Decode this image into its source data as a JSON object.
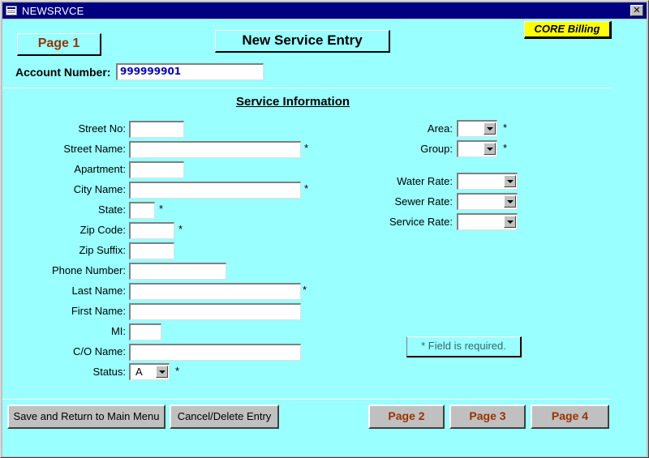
{
  "window": {
    "title": "NEWSRVCE",
    "close_glyph": "✕"
  },
  "header": {
    "page_label": "Page 1",
    "form_title": "New Service Entry",
    "badge": "CORE Billing",
    "account_number_label": "Account Number:",
    "account_number_value": "999999901"
  },
  "section": {
    "title": "Service Information"
  },
  "left_fields": {
    "street_no": {
      "label": "Street No:",
      "value": ""
    },
    "street_name": {
      "label": "Street Name:",
      "value": ""
    },
    "apartment": {
      "label": "Apartment:",
      "value": ""
    },
    "city_name": {
      "label": "City Name:",
      "value": ""
    },
    "state": {
      "label": "State:",
      "value": ""
    },
    "zip_code": {
      "label": "Zip Code:",
      "value": ""
    },
    "zip_suffix": {
      "label": "Zip Suffix:",
      "value": ""
    },
    "phone_number": {
      "label": "Phone Number:",
      "value": ""
    },
    "last_name": {
      "label": "Last Name:",
      "value": ""
    },
    "first_name": {
      "label": "First Name:",
      "value": ""
    },
    "mi": {
      "label": "MI:",
      "value": ""
    },
    "co_name": {
      "label": "C/O Name:",
      "value": ""
    },
    "status": {
      "label": "Status:",
      "value": "A"
    }
  },
  "right_fields": {
    "area": {
      "label": "Area:",
      "value": ""
    },
    "group": {
      "label": "Group:",
      "value": ""
    },
    "water_rate": {
      "label": "Water Rate:",
      "value": ""
    },
    "sewer_rate": {
      "label": "Sewer Rate:",
      "value": ""
    },
    "service_rate": {
      "label": "Service Rate:",
      "value": ""
    }
  },
  "required_marker": "*",
  "required_note": "* Field is required.",
  "buttons": {
    "save_return": "Save and Return to Main Menu",
    "cancel_delete": "Cancel/Delete Entry",
    "page2": "Page 2",
    "page3": "Page 3",
    "page4": "Page 4"
  },
  "colors": {
    "form_background": "#99ffff",
    "title_bar": "#000080",
    "page_label_text": "#993300",
    "badge_background": "#ffff00",
    "account_text": "#0000cc"
  }
}
